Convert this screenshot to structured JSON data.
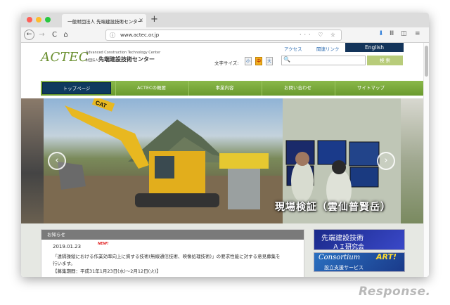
{
  "browser": {
    "tab_title": "一般財団法人 先端建設技術センター",
    "tab_close": "×",
    "new_tab": "+",
    "url": "www.actec.or.jp",
    "back": "←",
    "forward": "→",
    "reload": "C",
    "home": "⌂",
    "info": "ⓘ",
    "url_icons": "··· ♡ ☆",
    "download": "⬇",
    "library": "Ⅲ",
    "sidebar": "◫",
    "menu": "≡"
  },
  "site": {
    "logo": "ACTEC",
    "logo_english": "Advanced Construction Technology Center",
    "logo_prefix": "財団法人",
    "logo_japanese": "先端建設技術センター",
    "top_links": [
      "アクセス",
      "関連リンク"
    ],
    "english": "English",
    "font_size_label": "文字サイズ:",
    "font_sizes": [
      "小",
      "中",
      "大"
    ],
    "search_icon": "🔍",
    "search_button": "検 索"
  },
  "nav": [
    {
      "label": "トップページ"
    },
    {
      "label": "ACTECの概要"
    },
    {
      "label": "事業内容"
    },
    {
      "label": "お問い合わせ"
    },
    {
      "label": "サイトマップ"
    }
  ],
  "hero": {
    "caption": "現場検証（雲仙普賢岳）",
    "prev": "‹",
    "next": "›",
    "cat_label": "CAT"
  },
  "notice": {
    "heading": "お知らせ",
    "date": "2019.01.23",
    "new_badge": "NEW!",
    "lines": [
      "「遠隔操縦における作業効率向上に資する技術(無線通信技術、映像処理技術)」の要求性能に対する意見募集を",
      "行います。",
      "【募集期間：平成31年1月23日(水)～2月12日(火)】"
    ]
  },
  "banners": {
    "b1_title": "先端建設技術",
    "b1_sub": "ＡＩ研究会",
    "b2_title": "Consortium",
    "b2_art": "ART!",
    "b2_sub": "設立支援サービス"
  },
  "watermark": "Response."
}
